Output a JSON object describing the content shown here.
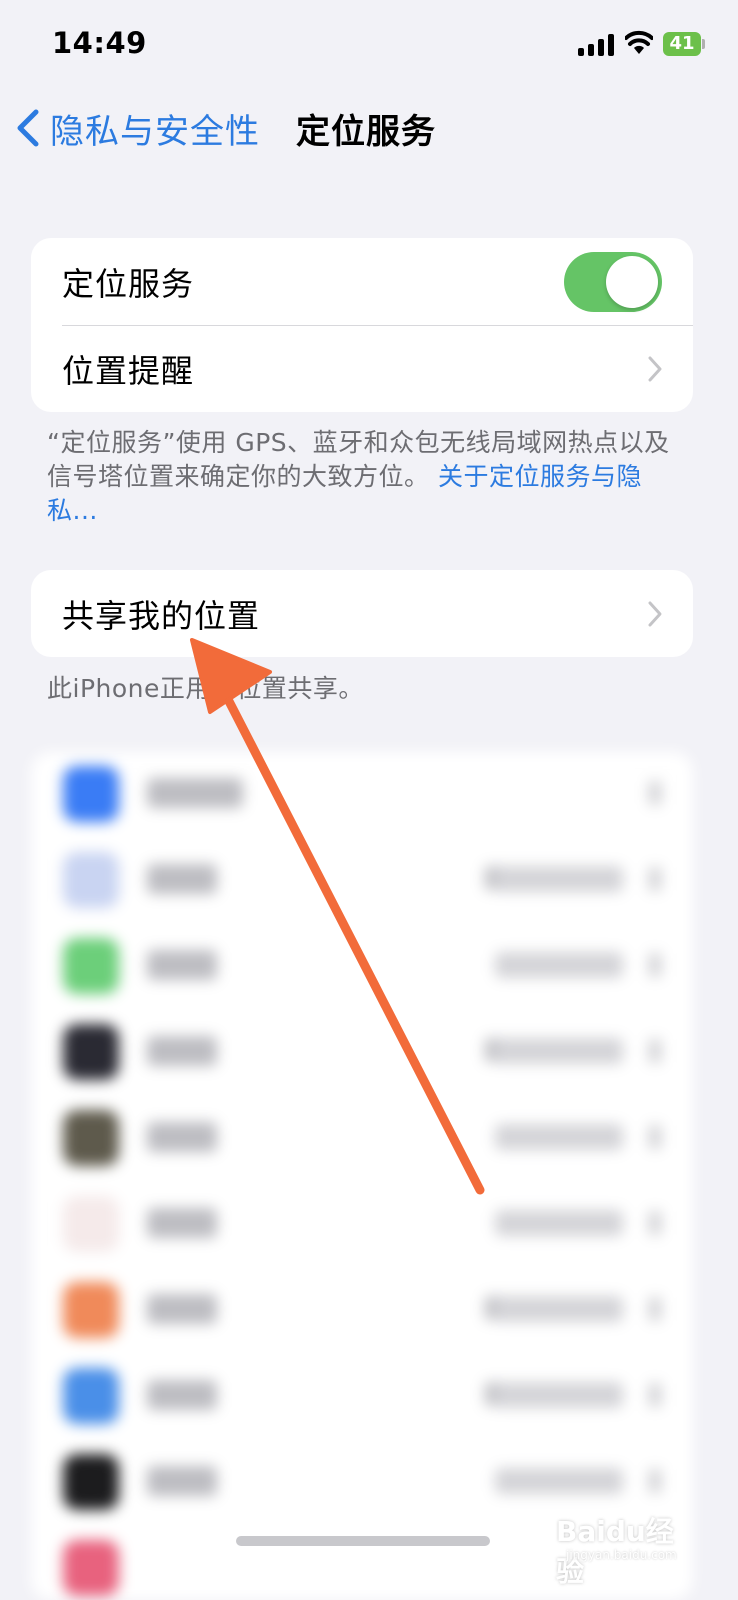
{
  "status_bar": {
    "time": "14:49",
    "battery": "41"
  },
  "nav": {
    "back_label": "隐私与安全性",
    "title": "定位服务"
  },
  "location_group": {
    "toggle_row_label": "定位服务",
    "toggle_on": true,
    "reminder_row_label": "位置提醒"
  },
  "location_footnote": {
    "text": "“定位服务”使用 GPS、蓝牙和众包无线局域网热点以及信号塔位置来确定你的大致方位。",
    "link": "关于定位服务与隐私..."
  },
  "share_group": {
    "row_label": "共享我的位置"
  },
  "share_footnote": "此iPhone正用于位置共享。",
  "watermark": {
    "brand": "Baidu经验",
    "url": "jingyan.baidu.com"
  },
  "colors": {
    "accent": "#2c7be0",
    "toggle_on": "#65c466",
    "arrow": "#f26b3a",
    "background": "#f2f2f7"
  }
}
